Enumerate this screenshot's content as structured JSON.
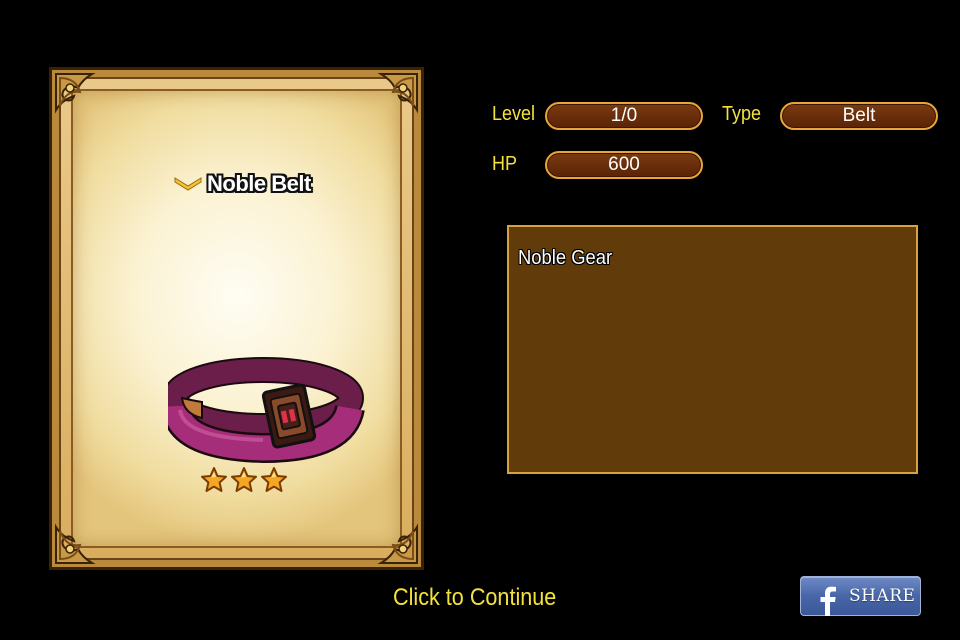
{
  "card": {
    "item_name": "Noble Belt",
    "rarity_stars": 3,
    "item_icon": "belt-icon"
  },
  "stats": {
    "level_label": "Level",
    "level_value": "1/0",
    "type_label": "Type",
    "type_value": "Belt",
    "hp_label": "HP",
    "hp_value": "600"
  },
  "description": {
    "text": "Noble Gear"
  },
  "footer": {
    "continue_label": "Click to Continue",
    "share_label": "SHARE",
    "share_icon": "facebook-icon"
  },
  "colors": {
    "label_yellow": "#f4e23a",
    "pill_brown": "#6a2f0b",
    "pill_border": "#e8a63a",
    "desc_bg": "#623b0b",
    "facebook_blue": "#3b5998"
  }
}
